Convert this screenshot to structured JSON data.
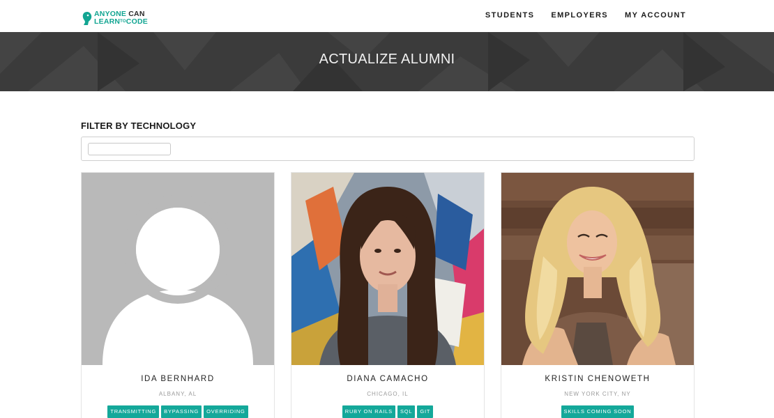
{
  "header": {
    "logo": {
      "line1_a": "ANYONE",
      "line1_b": "CAN",
      "line2_a": "LEARN",
      "line2_to": "TO",
      "line2_b": "CODE"
    },
    "nav": [
      {
        "label": "STUDENTS"
      },
      {
        "label": "EMPLOYERS"
      },
      {
        "label": "MY ACCOUNT"
      }
    ]
  },
  "banner": {
    "title": "ACTUALIZE ALUMNI"
  },
  "filter": {
    "label": "FILTER BY TECHNOLOGY",
    "value": ""
  },
  "alumni": [
    {
      "name": "IDA BERNHARD",
      "location": "ALBANY, AL",
      "tags": [
        "TRANSMITTING",
        "BYPASSING",
        "OVERRIDING"
      ]
    },
    {
      "name": "DIANA CAMACHO",
      "location": "CHICAGO, IL",
      "tags": [
        "RUBY ON RAILS",
        "SQL",
        "GIT"
      ]
    },
    {
      "name": "KRISTIN CHENOWETH",
      "location": "NEW YORK CITY, NY",
      "tags": [
        "SKILLS COMING SOON"
      ]
    }
  ],
  "colors": {
    "accent": "#14a89a",
    "banner": "#3a3a3a"
  }
}
